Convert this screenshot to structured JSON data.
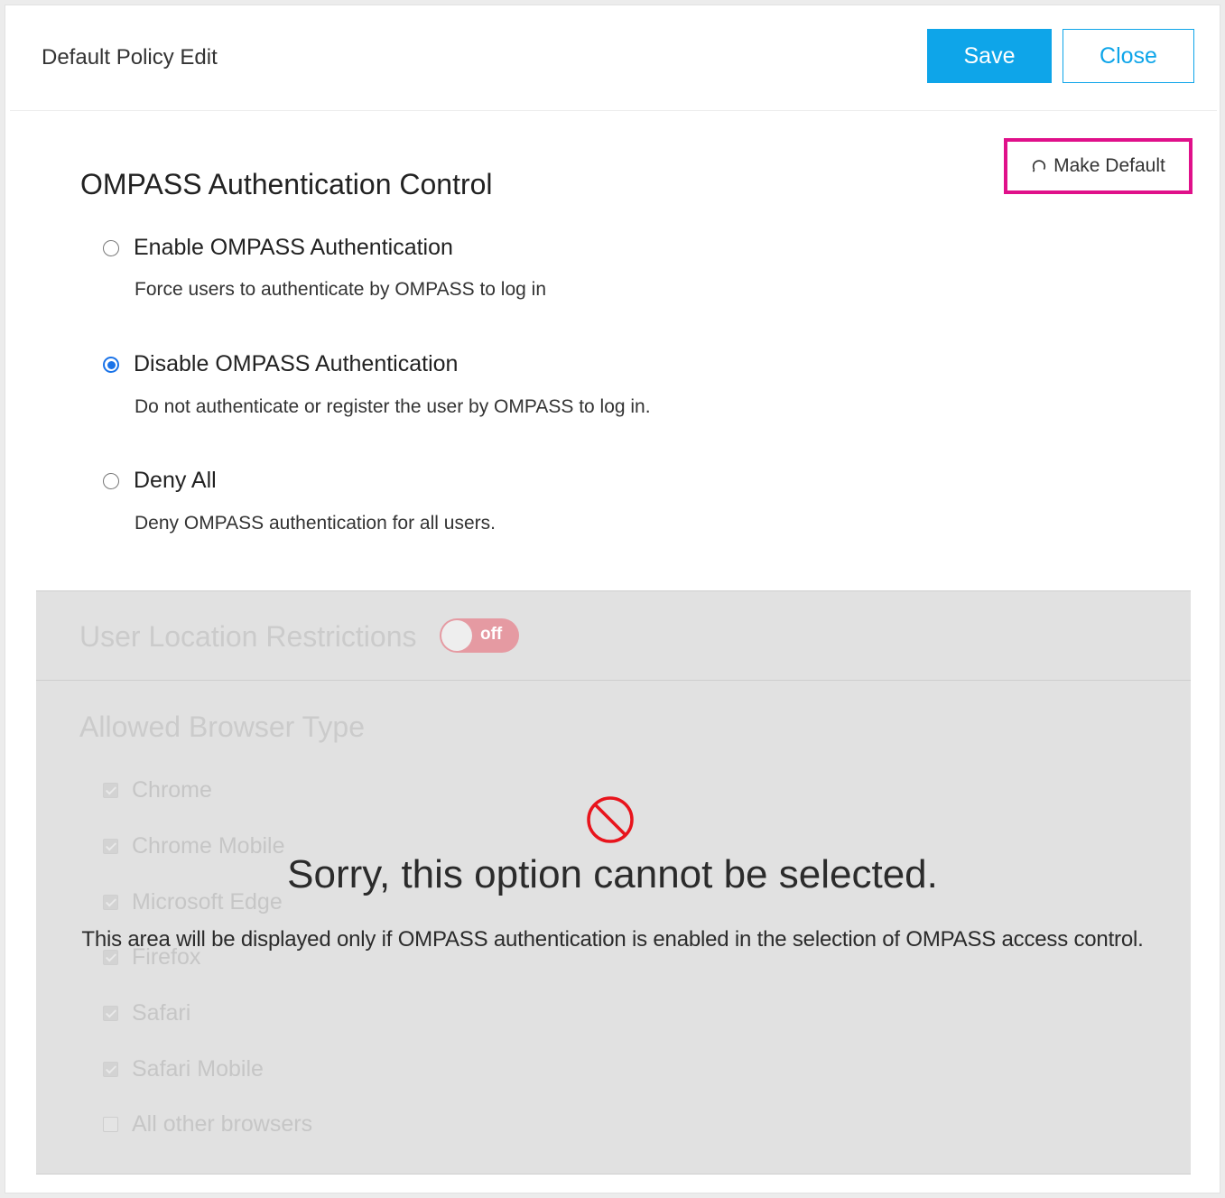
{
  "header": {
    "title": "Default Policy Edit",
    "save_label": "Save",
    "close_label": "Close"
  },
  "make_default": {
    "label": "Make Default",
    "icon": "refresh-icon",
    "highlight_color": "#e0108a"
  },
  "auth_control": {
    "title": "OMPASS Authentication Control",
    "options": [
      {
        "label": "Enable OMPASS Authentication",
        "description": "Force users to authenticate by OMPASS to log in",
        "selected": false
      },
      {
        "label": "Disable OMPASS Authentication",
        "description": "Do not authenticate or register the user by OMPASS to log in.",
        "selected": true
      },
      {
        "label": "Deny All",
        "description": "Deny OMPASS authentication for all users.",
        "selected": false
      }
    ]
  },
  "location_restrictions": {
    "title": "User Location Restrictions",
    "toggle_label": "off",
    "toggle_on": false
  },
  "browser_types": {
    "title": "Allowed Browser Type",
    "items": [
      {
        "label": "Chrome",
        "checked": true
      },
      {
        "label": "Chrome Mobile",
        "checked": true
      },
      {
        "label": "Microsoft Edge",
        "checked": true
      },
      {
        "label": "Firefox",
        "checked": true
      },
      {
        "label": "Safari",
        "checked": true
      },
      {
        "label": "Safari Mobile",
        "checked": true
      },
      {
        "label": "All other browsers",
        "checked": false
      }
    ]
  },
  "overlay": {
    "icon": "prohibited-icon",
    "message": "Sorry, this option cannot be selected.",
    "submessage": "This area will be displayed only if OMPASS authentication is enabled in the selection of OMPASS access control."
  },
  "colors": {
    "accent": "#0ea5e9",
    "radio_selected": "#1a73e8",
    "toggle_off": "#e59aa2",
    "prohibited": "#e8141c"
  }
}
